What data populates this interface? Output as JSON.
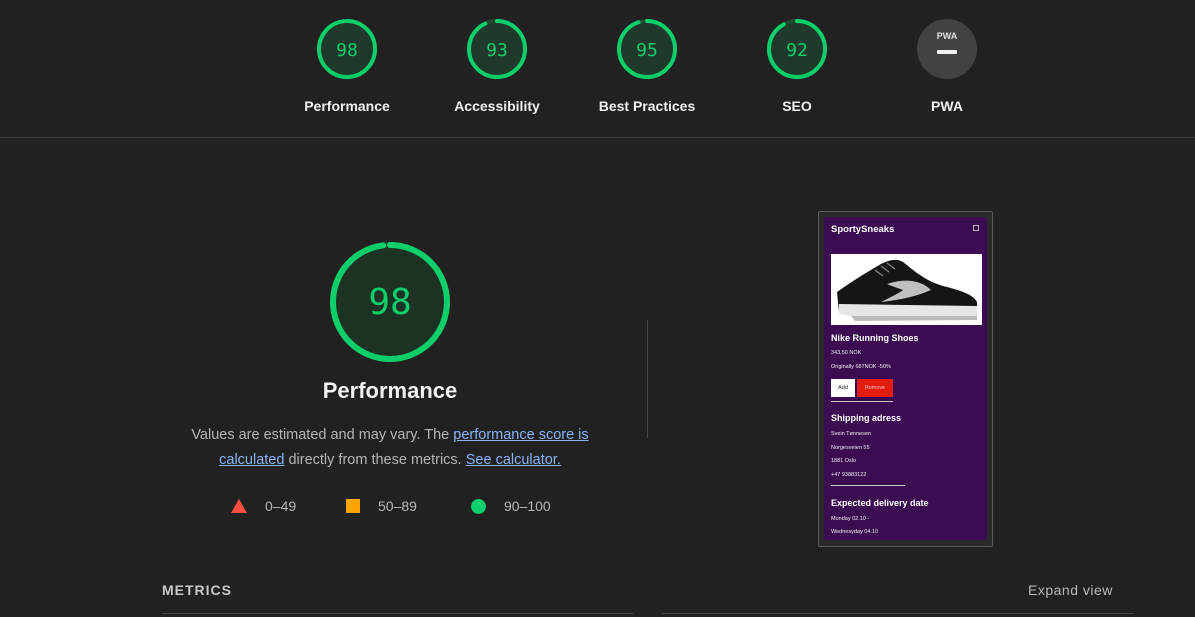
{
  "gauges": [
    {
      "label": "Performance",
      "score": "98",
      "value": 98,
      "color": "#0cce6b"
    },
    {
      "label": "Accessibility",
      "score": "93",
      "value": 93,
      "color": "#0cce6b"
    },
    {
      "label": "Best Practices",
      "score": "95",
      "value": 95,
      "color": "#0cce6b"
    },
    {
      "label": "SEO",
      "score": "92",
      "value": 92,
      "color": "#0cce6b"
    },
    {
      "label": "PWA",
      "badge": "PWA",
      "icon": "pwa-dash-icon"
    }
  ],
  "main": {
    "score": "98",
    "value": 98,
    "title": "Performance",
    "desc_prefix": "Values are estimated and may vary. The ",
    "desc_link1": "performance score is calculated",
    "desc_mid": " directly from these metrics. ",
    "desc_link2": "See calculator."
  },
  "legend": [
    {
      "range": "0–49",
      "icon": "fail-triangle-icon",
      "color": "#ff4e42"
    },
    {
      "range": "50–89",
      "icon": "average-square-icon",
      "color": "#ffa400"
    },
    {
      "range": "90–100",
      "icon": "pass-circle-icon",
      "color": "#0cce6b"
    }
  ],
  "screenshot": {
    "app_title": "SportySneaks",
    "product": "Nike Running Shoes",
    "price": "343,50 NOK",
    "original": "Originally 687NOK -50%",
    "add": "Add",
    "remove": "Remove",
    "shipping_title": "Shipping adress",
    "name": "Svein Tønnesen",
    "street": "Norgesveien 55",
    "city": "1881 Oslo",
    "phone": "+47 93883122",
    "delivery_title": "Expected delivery date",
    "delivery_from": "Monday 02.10 -",
    "delivery_to": "Wednesyday 04.10"
  },
  "metrics": {
    "heading": "METRICS",
    "expand": "Expand view"
  }
}
